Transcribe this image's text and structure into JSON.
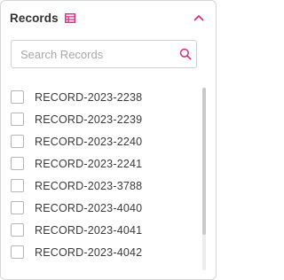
{
  "panel": {
    "title": "Records",
    "accent_color": "#e0267d"
  },
  "search": {
    "placeholder": "Search Records",
    "value": ""
  },
  "records": [
    {
      "label": "RECORD-2023-2238",
      "checked": false
    },
    {
      "label": "RECORD-2023-2239",
      "checked": false
    },
    {
      "label": "RECORD-2023-2240",
      "checked": false
    },
    {
      "label": "RECORD-2023-2241",
      "checked": false
    },
    {
      "label": "RECORD-2023-3788",
      "checked": false
    },
    {
      "label": "RECORD-2023-4040",
      "checked": false
    },
    {
      "label": "RECORD-2023-4041",
      "checked": false
    },
    {
      "label": "RECORD-2023-4042",
      "checked": false
    }
  ],
  "icons": {
    "header_icon": "table-icon",
    "collapse": "chevron-up-icon",
    "search": "search-icon"
  }
}
